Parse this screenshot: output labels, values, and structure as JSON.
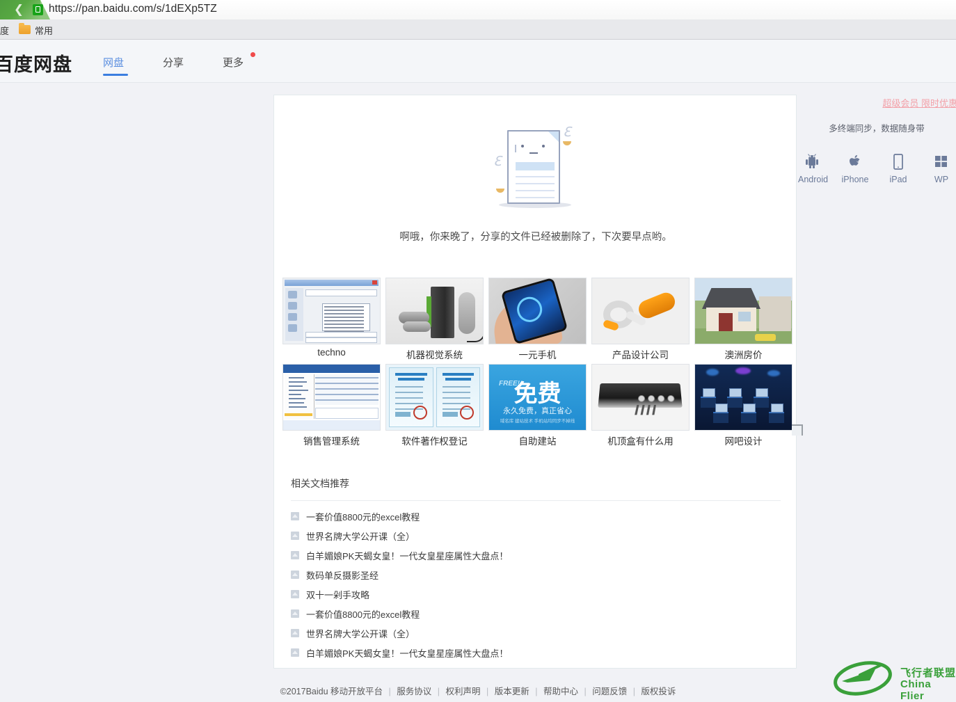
{
  "browser": {
    "back_icon": "chevron-left-icon",
    "lock_icon": "lock-icon",
    "url": "https://pan.baidu.com/s/1dEXp5TZ",
    "bookmarks": {
      "partial_label": "度",
      "folder_icon": "folder-icon",
      "folder_label": "常用"
    }
  },
  "header": {
    "logo": "百度网盘",
    "nav": [
      {
        "label": "网盘",
        "active": true
      },
      {
        "label": "分享",
        "active": false
      },
      {
        "label": "更多",
        "active": false,
        "badge": true
      }
    ],
    "vip_link": "超级会员 限时优惠"
  },
  "main": {
    "error_message": "啊哦，你来晚了，分享的文件已经被删除了，下次要早点哟。",
    "illustration": "broken-document-icon"
  },
  "thumbnails": {
    "rows": [
      [
        {
          "label": "techno",
          "art": "tn-win"
        },
        {
          "label": "机器视觉系统",
          "art": "tn-vision"
        },
        {
          "label": "一元手机",
          "art": "tn-phone"
        },
        {
          "label": "产品设计公司",
          "art": "tn-prod"
        },
        {
          "label": "澳洲房价",
          "art": "tn-house"
        }
      ],
      [
        {
          "label": "销售管理系统",
          "art": "tn-sales"
        },
        {
          "label": "软件著作权登记",
          "art": "tn-cert"
        },
        {
          "label": "自助建站",
          "art": "tn-free"
        },
        {
          "label": "机顶盒有什么用",
          "art": "tn-stb"
        },
        {
          "label": "网吧设计",
          "art": "tn-net"
        }
      ]
    ],
    "free_badge": {
      "big": "免费",
      "tag": "FREE!",
      "sub": "永久免费，真正省心",
      "sub2": "域名库  建站技术  手机站均同步不掉线"
    }
  },
  "related": {
    "title": "相关文档推荐",
    "items": [
      "一套价值8800元的excel教程",
      "世界名牌大学公开课（全）",
      "白羊媚娘PK天蝎女皇！一代女皇星座属性大盘点！",
      "数码单反摄影圣经",
      "双十一剁手攻略",
      "一套价值8800元的excel教程",
      "世界名牌大学公开课（全）",
      "白羊媚娘PK天蝎女皇！一代女皇星座属性大盘点！"
    ]
  },
  "sidebar": {
    "title": "多终端同步，数据随身带",
    "apps": [
      {
        "label": "Android",
        "icon": "android-icon"
      },
      {
        "label": "iPhone",
        "icon": "apple-icon"
      },
      {
        "label": "iPad",
        "icon": "tablet-icon"
      },
      {
        "label": "WP",
        "icon": "windows-phone-icon"
      }
    ]
  },
  "footer": {
    "copyright": "©2017Baidu 移动开放平台",
    "links": [
      "服务协议",
      "权利声明",
      "版本更新",
      "帮助中心",
      "问题反馈",
      "版权投诉"
    ]
  },
  "watermark": {
    "line1": "飞行者联盟",
    "line2": "China Flier",
    "color": "#3aa03a"
  },
  "colors": {
    "accent_blue": "#3b7ee0",
    "nav_active": "#5b8fe0",
    "vip_pink": "#f3a0a8",
    "page_bg": "#f1f2f6",
    "card_bg": "#ffffff",
    "badge_red": "#f04b4b"
  }
}
